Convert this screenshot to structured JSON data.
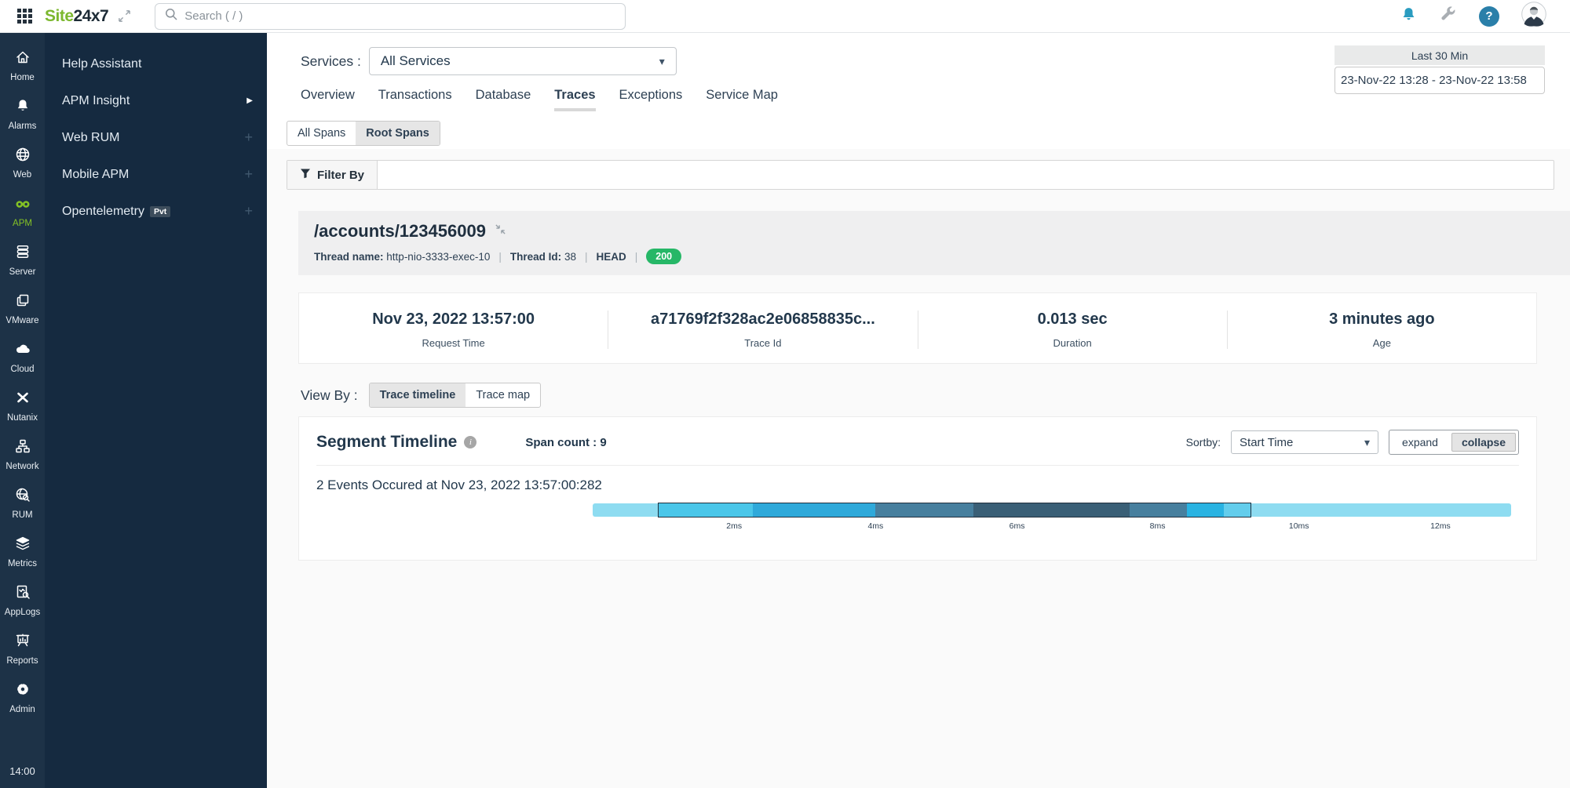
{
  "topbar": {
    "logo_site": "Site",
    "logo_rest": "24x7",
    "search_placeholder": "Search ( / )"
  },
  "sidebar": {
    "items": [
      {
        "label": "Home",
        "icon": "home-icon"
      },
      {
        "label": "Alarms",
        "icon": "bell-icon"
      },
      {
        "label": "Web",
        "icon": "globe-icon"
      },
      {
        "label": "APM",
        "icon": "binoculars-icon",
        "active": true
      },
      {
        "label": "Server",
        "icon": "server-icon"
      },
      {
        "label": "VMware",
        "icon": "vmware-icon"
      },
      {
        "label": "Cloud",
        "icon": "cloud-icon"
      },
      {
        "label": "Nutanix",
        "icon": "nutanix-icon"
      },
      {
        "label": "Network",
        "icon": "network-icon"
      },
      {
        "label": "RUM",
        "icon": "rum-icon"
      },
      {
        "label": "Metrics",
        "icon": "metrics-icon"
      },
      {
        "label": "AppLogs",
        "icon": "applogs-icon"
      },
      {
        "label": "Reports",
        "icon": "reports-icon"
      },
      {
        "label": "Admin",
        "icon": "admin-icon"
      }
    ],
    "clock": "14:00"
  },
  "panel": {
    "items": [
      {
        "label": "Help Assistant"
      },
      {
        "label": "APM Insight",
        "chevron": true
      },
      {
        "label": "Web RUM",
        "plus": true
      },
      {
        "label": "Mobile APM",
        "plus": true
      },
      {
        "label": "Opentelemetry",
        "badge": "Pvt",
        "plus": true
      }
    ]
  },
  "toolbar": {
    "services_label": "Services :",
    "services_value": "All Services",
    "time_quick": "Last 30 Min",
    "time_range": "23-Nov-22 13:28 - 23-Nov-22 13:58"
  },
  "tabs": {
    "items": [
      "Overview",
      "Transactions",
      "Database",
      "Traces",
      "Exceptions",
      "Service Map"
    ],
    "active": "Traces"
  },
  "spans_toggle": {
    "options": [
      "All Spans",
      "Root Spans"
    ],
    "active": 1
  },
  "filter": {
    "label": "Filter By"
  },
  "trace": {
    "title": "/accounts/123456009",
    "meta": {
      "thread_name_label": "Thread name:",
      "thread_name": "http-nio-3333-exec-10",
      "thread_id_label": "Thread Id:",
      "thread_id": "38",
      "method": "HEAD",
      "status_code": "200",
      "status_color": "#26b767"
    },
    "stats": [
      {
        "value": "Nov 23, 2022 13:57:00",
        "label": "Request Time"
      },
      {
        "value": "a71769f2f328ac2e06858835c...",
        "label": "Trace Id"
      },
      {
        "value": "0.013 sec",
        "label": "Duration"
      },
      {
        "value": "3 minutes ago",
        "label": "Age"
      }
    ]
  },
  "viewby": {
    "label": "View By :",
    "options": [
      "Trace timeline",
      "Trace map"
    ],
    "active": 0
  },
  "segment": {
    "title": "Segment Timeline",
    "span_count": "Span count : 9",
    "sortby_label": "Sortby:",
    "sortby_value": "Start Time",
    "expand_toggle": {
      "options": [
        "expand",
        "collapse"
      ],
      "active": 1
    },
    "events_text": "2 Events Occured at Nov 23, 2022 13:57:00:282"
  },
  "timeline": {
    "bar_color": "#8edcf1",
    "box": {
      "left_pct": 7.1,
      "width_pct": 64.6
    },
    "box_segments": [
      {
        "color": "#4ac6e9",
        "width_pct": 15.9
      },
      {
        "color": "#2fa9da",
        "width_pct": 20.8
      },
      {
        "color": "#477f9e",
        "width_pct": 16.5
      },
      {
        "color": "#3a5f76",
        "width_pct": 26.5
      },
      {
        "color": "#477f9e",
        "width_pct": 9.7
      },
      {
        "color": "#29b3e2",
        "width_pct": 6.2
      },
      {
        "color": "#63cdec",
        "width_pct": 4.5
      }
    ],
    "ticks": [
      {
        "label": "2ms",
        "pos_pct": 15.4
      },
      {
        "label": "4ms",
        "pos_pct": 30.8
      },
      {
        "label": "6ms",
        "pos_pct": 46.2
      },
      {
        "label": "8ms",
        "pos_pct": 61.5
      },
      {
        "label": "10ms",
        "pos_pct": 76.9
      },
      {
        "label": "12ms",
        "pos_pct": 92.3
      }
    ]
  }
}
